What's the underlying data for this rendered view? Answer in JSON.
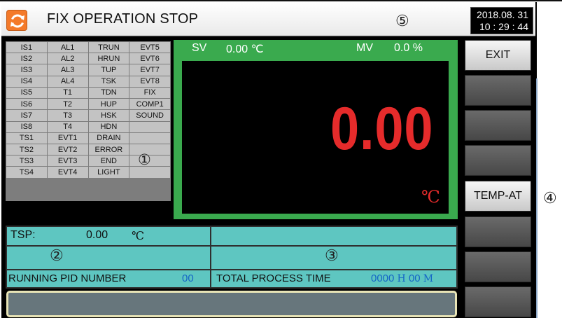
{
  "titlebar": {
    "refresh_icon": "refresh-icon",
    "title": "FIX OPERATION STOP",
    "callout_5": "⑤",
    "date": "2018.08. 31",
    "time": "10 : 29 : 44"
  },
  "status_grid": {
    "cells": [
      "IS1",
      "AL1",
      "TRUN",
      "EVT5",
      "IS2",
      "AL2",
      "HRUN",
      "EVT6",
      "IS3",
      "AL3",
      "TUP",
      "EVT7",
      "IS4",
      "AL4",
      "TSK",
      "EVT8",
      "IS5",
      "T1",
      "TDN",
      "FIX",
      "IS6",
      "T2",
      "HUP",
      "COMP1",
      "IS7",
      "T3",
      "HSK",
      "SOUND",
      "IS8",
      "T4",
      "HDN",
      "",
      "TS1",
      "EVT1",
      "DRAIN",
      "",
      "TS2",
      "EVT2",
      "ERROR",
      "",
      "TS3",
      "EVT3",
      "END",
      "",
      "TS4",
      "EVT4",
      "LIGHT",
      ""
    ],
    "callout_1": "①"
  },
  "monitor": {
    "sv_label": "SV",
    "sv_value": "0.00 ℃",
    "mv_label": "MV",
    "mv_value": "0.0 %",
    "big_value": "0.00",
    "big_unit": "℃",
    "accent_color": "#e52b2b"
  },
  "info": {
    "tsp_label": "TSP:",
    "tsp_value": "0.00",
    "tsp_unit": "℃",
    "callout_2": "②",
    "callout_3": "③",
    "pid_label": "RUNNING PID NUMBER",
    "pid_value": "00",
    "tpt_label": "TOTAL PROCESS TIME",
    "tpt_hours": "0000",
    "tpt_h_unit": "H",
    "tpt_minutes": "00",
    "tpt_m_unit": "M"
  },
  "side_buttons": {
    "exit_label": "EXIT",
    "temp_at_label": "TEMP-AT",
    "callout_4": "④"
  }
}
